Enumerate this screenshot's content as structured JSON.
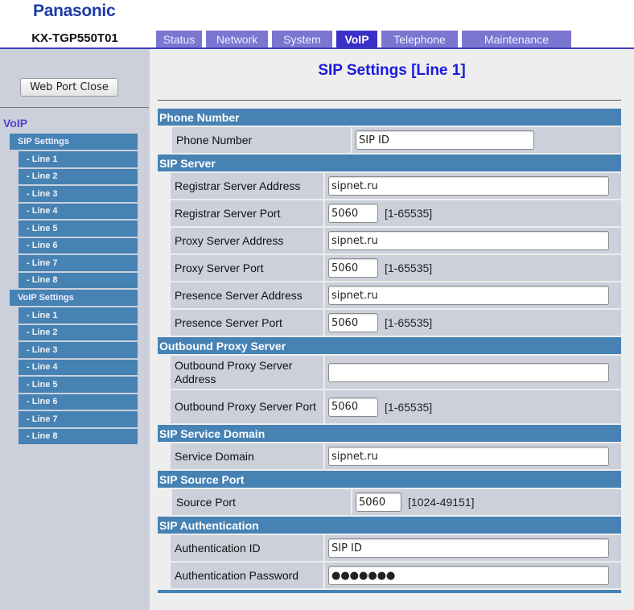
{
  "brand": "Panasonic",
  "model": "KX-TGP550T01",
  "tabs": [
    {
      "label": "Status",
      "active": false
    },
    {
      "label": "Network",
      "active": false
    },
    {
      "label": "System",
      "active": false
    },
    {
      "label": "VoIP",
      "active": true
    },
    {
      "label": "Telephone",
      "active": false
    },
    {
      "label": "Maintenance",
      "active": false
    }
  ],
  "sidebar": {
    "web_port_close": "Web Port Close",
    "section": "VoIP",
    "groups": [
      {
        "label": "SIP Settings",
        "items": [
          "- Line 1",
          "- Line 2",
          "- Line 3",
          "- Line 4",
          "- Line 5",
          "- Line 6",
          "- Line 7",
          "- Line 8"
        ]
      },
      {
        "label": "VoIP Settings",
        "items": [
          "- Line 1",
          "- Line 2",
          "- Line 3",
          "- Line 4",
          "- Line 5",
          "- Line 6",
          "- Line 7",
          "- Line 8"
        ]
      }
    ]
  },
  "page_title": "SIP Settings [Line 1]",
  "sections": {
    "phone_number": {
      "header": "Phone Number",
      "phone_number": {
        "label": "Phone Number",
        "value": "SIP ID"
      }
    },
    "sip_server": {
      "header": "SIP Server",
      "registrar_address": {
        "label": "Registrar Server Address",
        "value": "sipnet.ru"
      },
      "registrar_port": {
        "label": "Registrar Server Port",
        "value": "5060",
        "range": "[1-65535]"
      },
      "proxy_address": {
        "label": "Proxy Server Address",
        "value": "sipnet.ru"
      },
      "proxy_port": {
        "label": "Proxy Server Port",
        "value": "5060",
        "range": "[1-65535]"
      },
      "presence_address": {
        "label": "Presence Server Address",
        "value": "sipnet.ru"
      },
      "presence_port": {
        "label": "Presence Server Port",
        "value": "5060",
        "range": "[1-65535]"
      }
    },
    "outbound_proxy": {
      "header": "Outbound Proxy Server",
      "address": {
        "label": "Outbound Proxy Server Address",
        "value": ""
      },
      "port": {
        "label": "Outbound Proxy Server Port",
        "value": "5060",
        "range": "[1-65535]"
      }
    },
    "service_domain": {
      "header": "SIP Service Domain",
      "domain": {
        "label": "Service Domain",
        "value": "sipnet.ru"
      }
    },
    "source_port": {
      "header": "SIP Source Port",
      "port": {
        "label": "Source Port",
        "value": "5060",
        "range": "[1024-49151]"
      }
    },
    "authentication": {
      "header": "SIP Authentication",
      "id": {
        "label": "Authentication ID",
        "value": "SIP ID"
      },
      "password": {
        "label": "Authentication Password",
        "value": "●●●●●●●"
      }
    }
  },
  "colors": {
    "section_header": "#4682b4",
    "tab": "#7b76d0",
    "tab_active": "#3a30c8",
    "title": "#1a1ae0"
  }
}
